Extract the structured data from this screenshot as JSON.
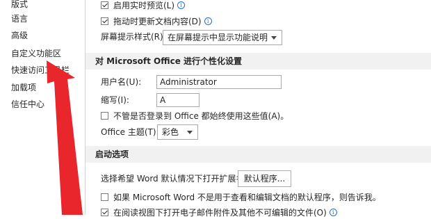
{
  "sidebar": {
    "items": [
      {
        "label": "版式"
      },
      {
        "label": "语言"
      },
      {
        "label": "高级"
      },
      {
        "label": "自定义功能区"
      },
      {
        "label": "快速访问工具栏"
      },
      {
        "label": "加载项"
      },
      {
        "label": "信任中心"
      }
    ]
  },
  "display": {
    "live_preview_label": "启用实时预览(L)",
    "update_on_drag_label": "拖动时更新文档内容(D)",
    "screentip_label": "屏幕提示样式(R):",
    "screentip_value": "在屏幕提示中显示功能说明"
  },
  "personalize": {
    "header": "对 Microsoft Office 进行个性化设置",
    "username_label": "用户名(U):",
    "username_value": "Administrator",
    "initials_label": "缩写(I):",
    "initials_value": "A",
    "always_use_label": "不管是否登录到 Office 都始终使用这些值(A)。",
    "theme_label": "Office 主题(T):",
    "theme_value": "彩色"
  },
  "startup": {
    "header": "启动选项",
    "default_ext_label": "选择希望 Word 默认情况下打开扩展名:",
    "default_programs_button": "默认程序...",
    "tell_me_label": "如果 Microsoft Word 不是用于查看和编辑文档的默认程序，则告诉我。",
    "reading_view_label": "在阅读视图下打开电子邮件附件及其他不可编辑的文件(O)"
  },
  "colors": {
    "arrow": "#e8262b",
    "section_bg": "#f1f1f1",
    "info": "#2b6cc4"
  }
}
